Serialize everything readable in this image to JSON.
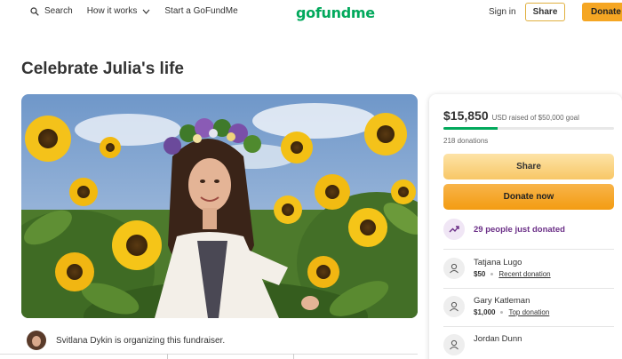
{
  "nav": {
    "search": "Search",
    "how_it_works": "How it works",
    "start": "Start a GoFundMe",
    "logo": "gofundme",
    "sign_in": "Sign in",
    "share": "Share",
    "donate": "Donate"
  },
  "campaign": {
    "title": "Celebrate Julia's life",
    "organizer_text": "Svitlana Dykin is organizing this fundraiser."
  },
  "sidebar": {
    "raised_amount": "$15,850",
    "raised_goal": "USD raised of $50,000 goal",
    "progress_fraction": 0.317,
    "donations_count": "218 donations",
    "share_label": "Share",
    "donate_label": "Donate now",
    "trend_text": "29 people just donated",
    "donors": [
      {
        "name": "Tatjana Lugo",
        "amount": "$50",
        "tag": "Recent donation"
      },
      {
        "name": "Gary Katleman",
        "amount": "$1,000",
        "tag": "Top donation"
      },
      {
        "name": "Jordan Dunn",
        "amount": "",
        "tag": ""
      }
    ]
  },
  "colors": {
    "brand_green": "#02a95c",
    "donate_orange": "#f5a623",
    "trend_purple": "#6b2f87"
  },
  "icons": [
    "search-icon",
    "chevron-down-icon",
    "trend-up-icon",
    "donor-avatar-icon"
  ]
}
